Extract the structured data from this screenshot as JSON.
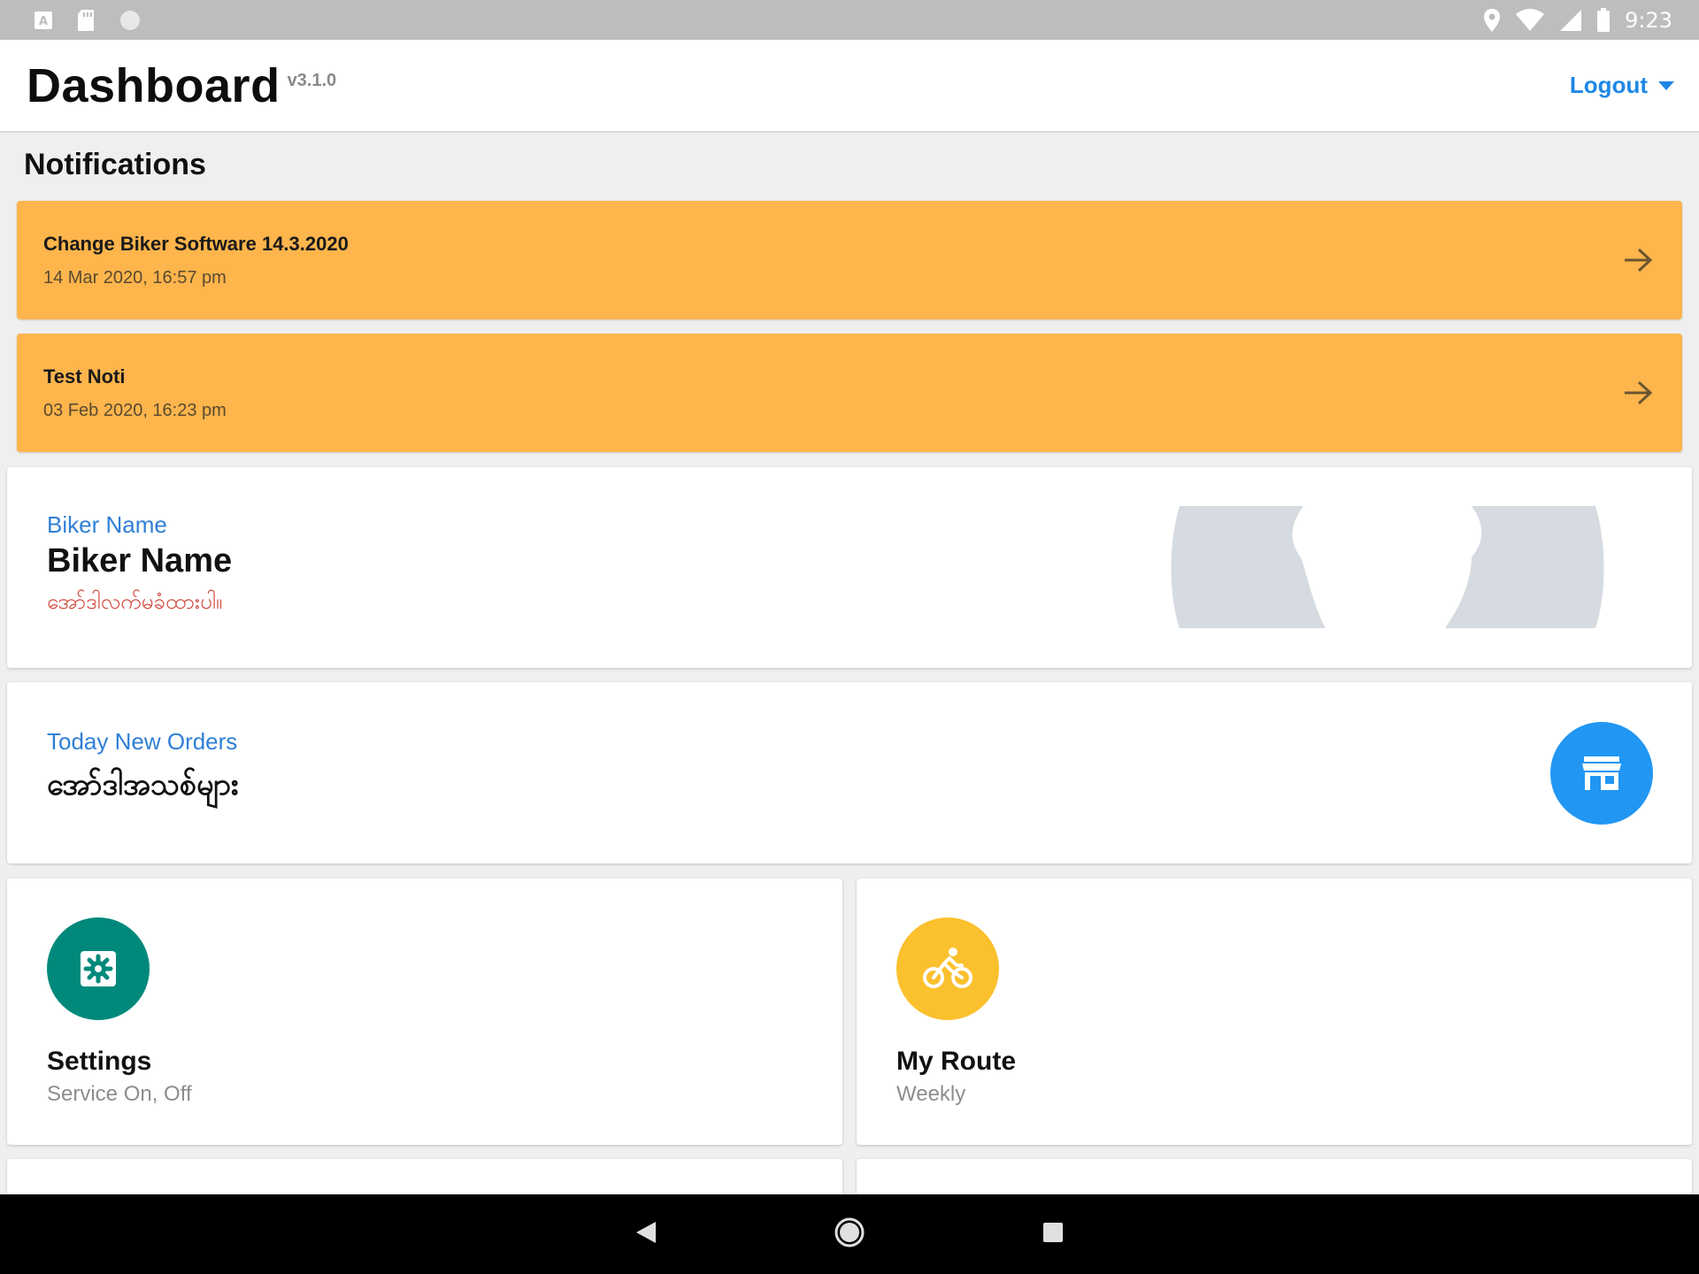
{
  "status_bar": {
    "time": "9:23",
    "left_icons": [
      "keyboard-a-icon",
      "sd-card-icon",
      "circle-status-icon"
    ],
    "right_icons": [
      "location-icon",
      "wifi-icon",
      "signal-icon",
      "battery-icon"
    ]
  },
  "header": {
    "title": "Dashboard",
    "version": "v3.1.0",
    "logout_label": "Logout"
  },
  "notifications": {
    "title": "Notifications",
    "items": [
      {
        "title": "Change Biker Software 14.3.2020",
        "date": "14 Mar 2020, 16:57 pm"
      },
      {
        "title": "Test Noti",
        "date": "03 Feb 2020, 16:23 pm"
      }
    ],
    "color": "#fdb54c"
  },
  "biker_card": {
    "label": "Biker Name",
    "name": "Biker Name",
    "status": "အော်ဒါလက်မခံထားပါ။"
  },
  "orders_card": {
    "label": "Today New Orders",
    "value": "အော်ဒါအသစ်များ",
    "icon": "store-icon",
    "icon_color": "#2196f3"
  },
  "menu": [
    {
      "title": "Settings",
      "subtitle": "Service On, Off",
      "icon": "settings-icon",
      "color": "#00897b"
    },
    {
      "title": "My Route",
      "subtitle": "Weekly",
      "icon": "bike-icon",
      "color": "#fbc02d"
    }
  ],
  "nav": {
    "icons": [
      "back-icon",
      "home-icon",
      "recents-icon"
    ]
  }
}
